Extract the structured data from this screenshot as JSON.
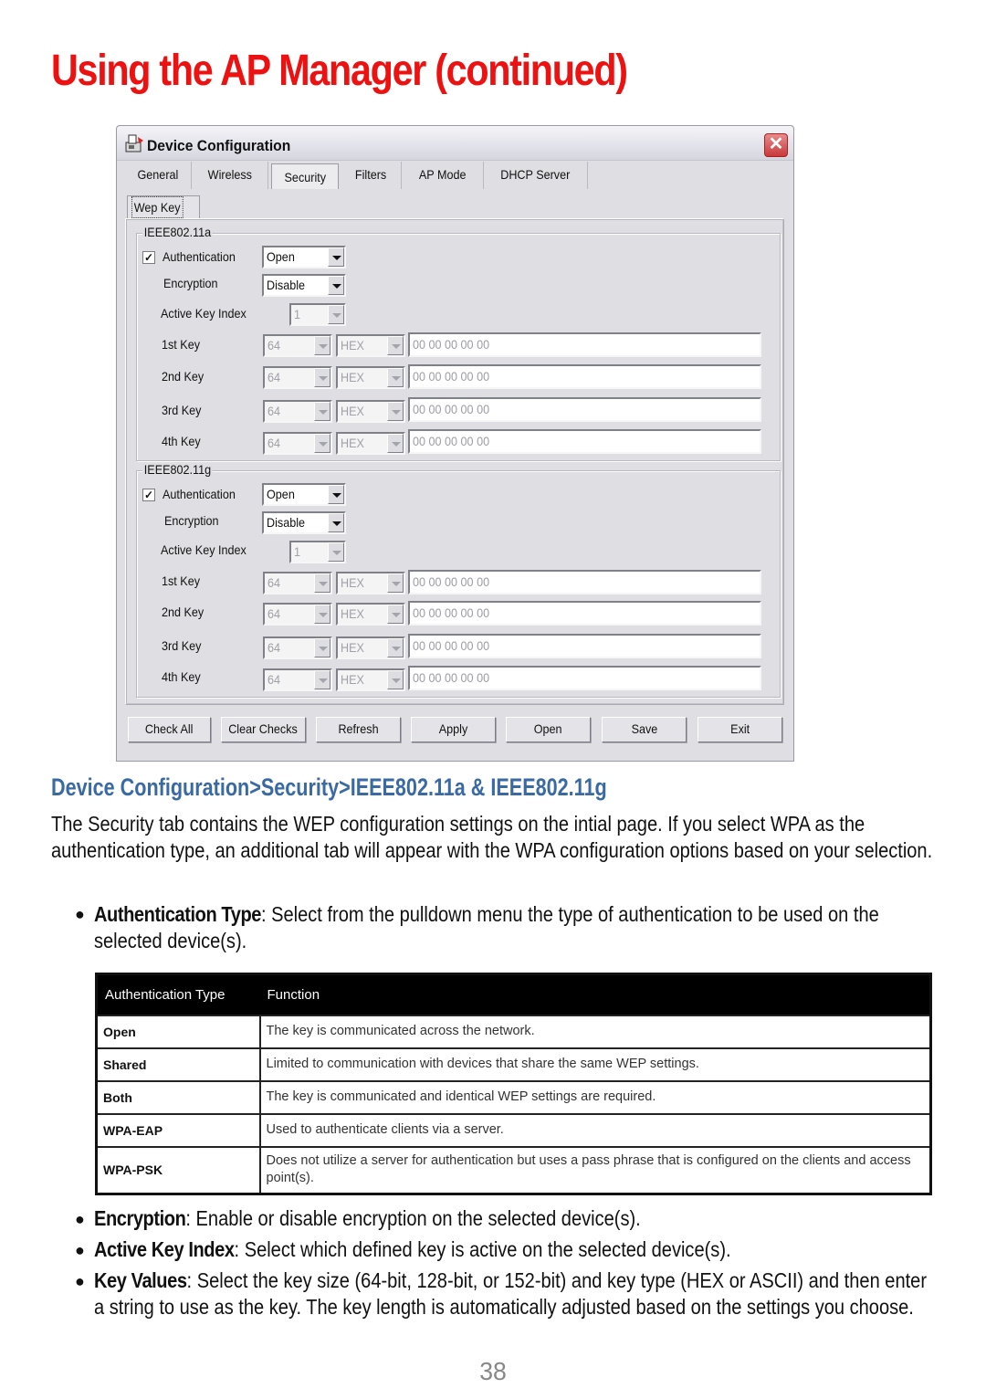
{
  "page": {
    "title": "Using the AP Manager (continued)",
    "page_number": "38"
  },
  "window": {
    "title": "Device Configuration",
    "app_icon": "device-config-icon",
    "close_icon": "close-icon",
    "tabs": [
      {
        "label": "General",
        "active": false
      },
      {
        "label": "Wireless",
        "active": false
      },
      {
        "label": "Security",
        "active": true
      },
      {
        "label": "Filters",
        "active": false
      },
      {
        "label": "AP Mode",
        "active": false
      },
      {
        "label": "DHCP Server",
        "active": false
      }
    ],
    "subtab": "Wep Key",
    "groups": [
      {
        "legend": "IEEE802.11a",
        "authentication": {
          "label": "Authentication",
          "checked": true,
          "value": "Open"
        },
        "encryption": {
          "label": "Encryption",
          "value": "Disable"
        },
        "active_key_index": {
          "label": "Active Key Index",
          "value": "1"
        },
        "keys": [
          {
            "label": "1st Key",
            "size": "64",
            "type": "HEX",
            "value": "00 00 00 00 00"
          },
          {
            "label": "2nd Key",
            "size": "64",
            "type": "HEX",
            "value": "00 00 00 00 00"
          },
          {
            "label": "3rd Key",
            "size": "64",
            "type": "HEX",
            "value": "00 00 00 00 00"
          },
          {
            "label": "4th Key",
            "size": "64",
            "type": "HEX",
            "value": "00 00 00 00 00"
          }
        ]
      },
      {
        "legend": "IEEE802.11g",
        "authentication": {
          "label": "Authentication",
          "checked": true,
          "value": "Open"
        },
        "encryption": {
          "label": "Encryption",
          "value": "Disable"
        },
        "active_key_index": {
          "label": "Active Key Index",
          "value": "1"
        },
        "keys": [
          {
            "label": "1st Key",
            "size": "64",
            "type": "HEX",
            "value": "00 00 00 00 00"
          },
          {
            "label": "2nd Key",
            "size": "64",
            "type": "HEX",
            "value": "00 00 00 00 00"
          },
          {
            "label": "3rd Key",
            "size": "64",
            "type": "HEX",
            "value": "00 00 00 00 00"
          },
          {
            "label": "4th Key",
            "size": "64",
            "type": "HEX",
            "value": "00 00 00 00 00"
          }
        ]
      }
    ],
    "buttons": [
      "Check All",
      "Clear Checks",
      "Refresh",
      "Apply",
      "Open",
      "Save",
      "Exit"
    ]
  },
  "section": {
    "title": "Device Configuration>Security>IEEE802.11a & IEEE802.11g",
    "intro": "The Security tab contains the WEP configuration settings on the intial page. If you select WPA as the authentication type, an additional tab will appear with the WPA configuration options based on your selection.",
    "bullets": [
      {
        "term": "Authentication Type",
        "text": ": Select from the pulldown menu the type of authentication to be used on the selected device(s)."
      },
      {
        "term": "Encryption",
        "text": ": Enable or disable encryption on the selected device(s)."
      },
      {
        "term": "Active Key Index",
        "text": ": Select which defined key is active on the selected device(s)."
      },
      {
        "term": "Key Values",
        "text": ": Select the key size (64-bit, 128-bit, or 152-bit) and key type (HEX or ASCII) and then enter a string to use as the key. The key length is automatically adjusted based on the settings you choose."
      }
    ]
  },
  "auth_table": {
    "headers": [
      "Authentication Type",
      "Function"
    ],
    "rows": [
      {
        "type": "Open",
        "function": "The key is communicated across the network."
      },
      {
        "type": "Shared",
        "function": "Limited to communication with devices that share the same WEP settings."
      },
      {
        "type": "Both",
        "function": "The key is communicated and identical WEP settings are required."
      },
      {
        "type": "WPA-EAP",
        "function": "Used to authenticate clients via a server."
      },
      {
        "type": "WPA-PSK",
        "function": "Does not utilize a server for authentication but uses a pass phrase that is configured on the clients and access point(s)."
      }
    ]
  },
  "colors": {
    "title_red": "#ee1111",
    "section_blue": "#3a6aa4",
    "window_bg": "#dfdfe3",
    "close_red": "#c83a3a"
  }
}
